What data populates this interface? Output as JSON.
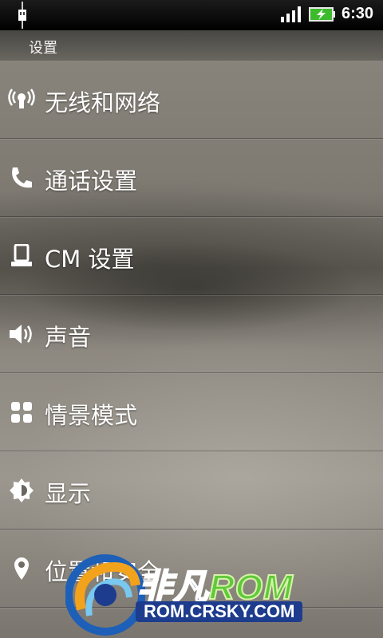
{
  "status_bar": {
    "time": "6:30",
    "icons": [
      "usb-icon",
      "signal-icon",
      "battery-charging-icon"
    ]
  },
  "title_bar": {
    "title": "设置"
  },
  "settings": {
    "items": [
      {
        "label": "无线和网络",
        "icon": "wireless-icon"
      },
      {
        "label": "通话设置",
        "icon": "phone-icon"
      },
      {
        "label": "CM 设置",
        "icon": "device-icon"
      },
      {
        "label": "声音",
        "icon": "speaker-icon"
      },
      {
        "label": "情景模式",
        "icon": "grid-icon"
      },
      {
        "label": "显示",
        "icon": "brightness-icon"
      },
      {
        "label": "位置和安全",
        "icon": "location-icon"
      }
    ]
  },
  "watermark": {
    "brand_cn": "非凡",
    "brand_rom": "ROM",
    "url": "ROM.CRSKY.COM"
  },
  "colors": {
    "status_bar_bg": "#000000",
    "text": "#ffffff",
    "battery_green": "#3dbb2c",
    "watermark_green": "#5fc93a",
    "watermark_blue": "#1e3c8e"
  }
}
